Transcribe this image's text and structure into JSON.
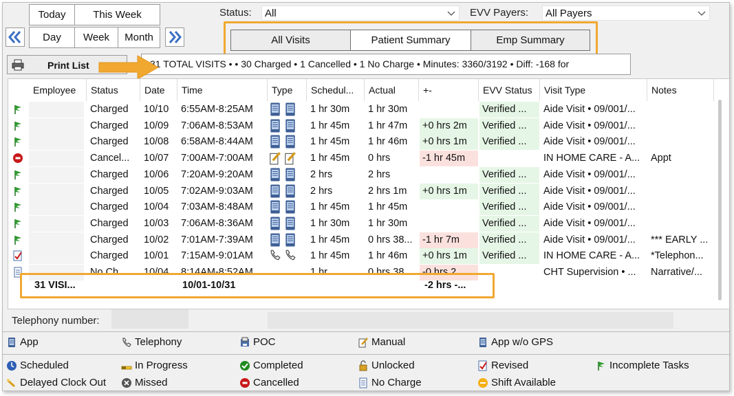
{
  "toolbar": {
    "today": "Today",
    "this_week": "This Week",
    "day": "Day",
    "week": "Week",
    "month": "Month",
    "prev_icon": "double-chevron-left-icon",
    "next_icon": "double-chevron-right-icon"
  },
  "filters": {
    "status_label": "Status:",
    "status_value": "All",
    "evv_label": "EVV Payers:",
    "evv_value": "All Payers"
  },
  "tabs": [
    "All Visits",
    "Patient Summary",
    "Emp Summary"
  ],
  "print": {
    "label": "Print List",
    "icon": "printer-icon"
  },
  "summary": "31 TOTAL VISITS •  • 30 Charged • 1 Cancelled • 1 No Charge •  Minutes: 3360/3192 • Diff: -168 for",
  "grid": {
    "columns": [
      "Employee",
      "Status",
      "Date",
      "Time",
      "Type",
      "Schedul...",
      "Actual",
      "+-",
      "EVV Status",
      "Visit Type",
      "Notes"
    ],
    "rows": [
      {
        "icon": "green-flag-icon",
        "status": "Charged",
        "date": "10/10",
        "time": "6:55AM-8:25AM",
        "type": "app",
        "sched": "1 hr 30m",
        "actual": "1 hr 30m",
        "diff": "",
        "diff_tone": "",
        "evv": "Verified ...",
        "visit_type": "Aide Visit • 09/001/...",
        "notes": ""
      },
      {
        "icon": "green-flag-icon",
        "status": "Charged",
        "date": "10/09",
        "time": "7:06AM-8:53AM",
        "type": "app",
        "sched": "1 hr 45m",
        "actual": "1 hr 47m",
        "diff": "+0 hrs 2m",
        "diff_tone": "pos",
        "evv": "Verified ...",
        "visit_type": "Aide Visit • 09/001/...",
        "notes": ""
      },
      {
        "icon": "green-flag-icon",
        "status": "Charged",
        "date": "10/08",
        "time": "6:58AM-8:44AM",
        "type": "app",
        "sched": "1 hr 45m",
        "actual": "1 hr 46m",
        "diff": "+0 hrs 1m",
        "diff_tone": "pos",
        "evv": "Verified ...",
        "visit_type": "Aide Visit • 09/001/...",
        "notes": ""
      },
      {
        "icon": "cancelled-icon",
        "status": "Cancel...",
        "date": "10/07",
        "time": "7:00AM-7:00AM",
        "type": "manual",
        "sched": "1 hr 45m",
        "actual": "0 hrs",
        "diff": "-1 hr 45m",
        "diff_tone": "neg",
        "evv": "",
        "visit_type": "IN HOME CARE - A...",
        "notes": "Appt"
      },
      {
        "icon": "green-flag-icon",
        "status": "Charged",
        "date": "10/06",
        "time": "7:20AM-9:20AM",
        "type": "app",
        "sched": "2 hrs",
        "actual": "2 hrs",
        "diff": "",
        "diff_tone": "",
        "evv": "Verified ...",
        "visit_type": "Aide Visit • 09/001/...",
        "notes": ""
      },
      {
        "icon": "green-flag-icon",
        "status": "Charged",
        "date": "10/05",
        "time": "7:02AM-9:03AM",
        "type": "app",
        "sched": "2 hrs",
        "actual": "2 hrs 1m",
        "diff": "+0 hrs 1m",
        "diff_tone": "pos",
        "evv": "Verified ...",
        "visit_type": "Aide Visit • 09/001/...",
        "notes": ""
      },
      {
        "icon": "green-flag-icon",
        "status": "Charged",
        "date": "10/04",
        "time": "7:03AM-8:48AM",
        "type": "app",
        "sched": "1 hr 45m",
        "actual": "1 hr 45m",
        "diff": "",
        "diff_tone": "",
        "evv": "Verified ...",
        "visit_type": "Aide Visit • 09/001/...",
        "notes": ""
      },
      {
        "icon": "green-flag-icon",
        "status": "Charged",
        "date": "10/03",
        "time": "7:06AM-8:36AM",
        "type": "app",
        "sched": "1 hr 30m",
        "actual": "1 hr 30m",
        "diff": "",
        "diff_tone": "",
        "evv": "Verified ...",
        "visit_type": "Aide Visit • 09/001/...",
        "notes": ""
      },
      {
        "icon": "green-flag-icon",
        "status": "Charged",
        "date": "10/02",
        "time": "7:01AM-7:39AM",
        "type": "app",
        "sched": "1 hr 45m",
        "actual": "0 hrs 38...",
        "diff": "-1 hr 7m",
        "diff_tone": "neg",
        "evv": "Verified ...",
        "visit_type": "Aide Visit • 09/001/...",
        "notes": "*** EARLY ..."
      },
      {
        "icon": "revised-icon",
        "status": "Charged",
        "date": "10/01",
        "time": "7:15AM-9:01AM",
        "type": "telephony",
        "sched": "1 hr 45m",
        "actual": "1 hr 46m",
        "diff": "+0 hrs 1m",
        "diff_tone": "pos",
        "evv": "Verified ...",
        "visit_type": "IN HOME CARE - A...",
        "notes": "*Telephon..."
      },
      {
        "icon": "no-charge-icon",
        "status": "No Ch...",
        "date": "10/04",
        "time": "8:14AM-8:52AM",
        "type": "none",
        "sched": "1 hr",
        "actual": "0 hrs 38...",
        "diff": "-0 hrs 2...",
        "diff_tone": "neg",
        "evv": "",
        "visit_type": "CHT Supervision • ...",
        "notes": "Narrative/..."
      }
    ],
    "footer": {
      "visits": "31 VISI...",
      "range": "10/01-10/31",
      "diff": "-2 hrs -..."
    }
  },
  "telephony_label": "Telephony number:",
  "legend_types": [
    {
      "icon": "app-icon",
      "label": "App"
    },
    {
      "icon": "telephony-icon",
      "label": "Telephony"
    },
    {
      "icon": "poc-icon",
      "label": "POC"
    },
    {
      "icon": "manual-icon",
      "label": "Manual"
    },
    {
      "icon": "app-no-gps-icon",
      "label": "App w/o GPS"
    }
  ],
  "legend_status": [
    {
      "icon": "scheduled-icon",
      "label": "Scheduled"
    },
    {
      "icon": "in-progress-icon",
      "label": "In Progress"
    },
    {
      "icon": "completed-icon",
      "label": "Completed"
    },
    {
      "icon": "unlocked-icon",
      "label": "Unlocked"
    },
    {
      "icon": "revised-icon",
      "label": "Revised"
    },
    {
      "icon": "incomplete-tasks-icon",
      "label": "Incomplete Tasks"
    },
    {
      "icon": "delayed-clock-out-icon",
      "label": "Delayed Clock Out"
    },
    {
      "icon": "missed-icon",
      "label": "Missed"
    },
    {
      "icon": "cancelled-icon",
      "label": "Cancelled"
    },
    {
      "icon": "no-charge-icon",
      "label": "No Charge"
    },
    {
      "icon": "shift-available-icon",
      "label": "Shift Available"
    }
  ],
  "colors": {
    "highlight": "#f0a830",
    "verified_bg": "#e6f6e6",
    "negative_bg": "#fbe1de",
    "nav_blue": "#3a6fc4"
  }
}
